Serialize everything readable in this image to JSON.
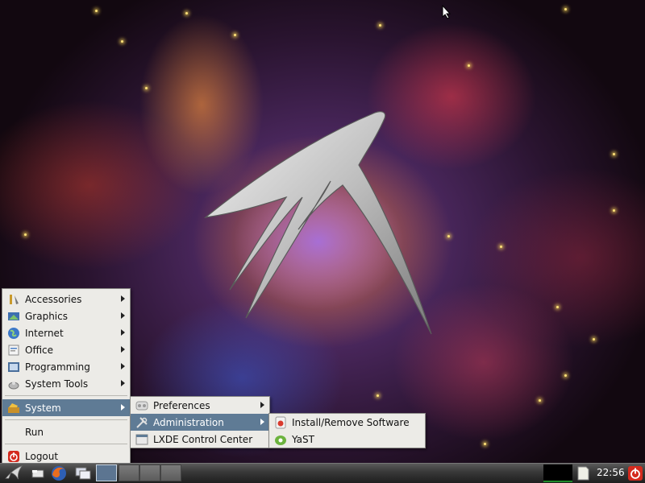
{
  "main_menu": {
    "items": [
      {
        "label": "Accessories",
        "icon": "accessories-icon"
      },
      {
        "label": "Graphics",
        "icon": "graphics-icon"
      },
      {
        "label": "Internet",
        "icon": "internet-icon"
      },
      {
        "label": "Office",
        "icon": "office-icon"
      },
      {
        "label": "Programming",
        "icon": "programming-icon"
      },
      {
        "label": "System Tools",
        "icon": "system-tools-icon"
      },
      {
        "label": "System",
        "icon": "system-icon",
        "selected": true
      },
      {
        "label": "Run"
      },
      {
        "label": "Logout",
        "icon": "logout-icon"
      }
    ]
  },
  "system_submenu": {
    "items": [
      {
        "label": "Preferences",
        "icon": "preferences-icon"
      },
      {
        "label": "Administration",
        "icon": "administration-icon",
        "selected": true
      },
      {
        "label": "LXDE Control Center",
        "icon": "control-center-icon"
      }
    ]
  },
  "administration_submenu": {
    "items": [
      {
        "label": "Install/Remove Software",
        "icon": "install-software-icon"
      },
      {
        "label": "YaST",
        "icon": "yast-icon"
      }
    ]
  },
  "taskbar": {
    "clock": "22:56",
    "launchers": [
      "start-menu-icon",
      "file-manager-icon",
      "firefox-icon",
      "window-switcher-icon"
    ],
    "desktops": 4,
    "active_desktop": 1
  },
  "colors": {
    "menu_bg": "#ecebe7",
    "menu_selected": "#5f7b95",
    "taskbar": "#2a2a2a",
    "power_button": "#d42a1e"
  }
}
